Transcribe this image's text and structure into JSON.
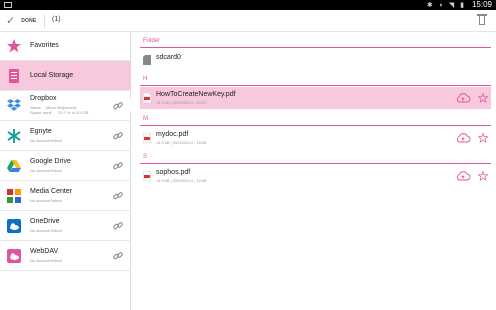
{
  "status_bar": {
    "time": "15:09",
    "icons": [
      "bluetooth-icon",
      "vibrate-icon",
      "wifi-icon",
      "battery-icon"
    ]
  },
  "action_bar": {
    "done_label": "DONE",
    "selected_count": "(1)"
  },
  "sidebar": {
    "items": [
      {
        "title": "Favorites",
        "icon": "star-icon"
      },
      {
        "title": "Local Storage",
        "icon": "local-storage-icon",
        "selected": true
      },
      {
        "title": "Dropbox",
        "icon": "dropbox-icon",
        "name_label": "Name:",
        "name_value": "Mirza Mujkanovic",
        "space_label": "Space used:",
        "space_value": "20.7 % of 3.5 GB"
      },
      {
        "title": "Egnyte",
        "icon": "egnyte-icon",
        "subtitle": "No account linked"
      },
      {
        "title": "Google Drive",
        "icon": "google-drive-icon",
        "subtitle": "No account linked"
      },
      {
        "title": "Media Center",
        "icon": "media-center-icon",
        "subtitle": "No account linked"
      },
      {
        "title": "OneDrive",
        "icon": "onedrive-icon",
        "subtitle": "No account linked"
      },
      {
        "title": "WebDAV",
        "icon": "webdav-icon",
        "subtitle": "No account linked"
      }
    ]
  },
  "main": {
    "sections": [
      {
        "header": "Folder"
      },
      {
        "header": "H"
      },
      {
        "header": "M"
      },
      {
        "header": "S"
      }
    ],
    "folder": {
      "name": "sdcard0"
    },
    "files": [
      {
        "name": "HowToCreateNewKey.pdf",
        "meta": "14.9 kB | 20/03/2014 - 15:07",
        "selected": true
      },
      {
        "name": "mydoc.pdf",
        "meta": "14.9 kB | 20/03/2014 - 15:06"
      },
      {
        "name": "sophos.pdf",
        "meta": "14.9 kB | 20/03/2014 - 15:06"
      }
    ]
  },
  "colors": {
    "accent": "#e0559b",
    "selected_bg": "#f8c8dc"
  }
}
